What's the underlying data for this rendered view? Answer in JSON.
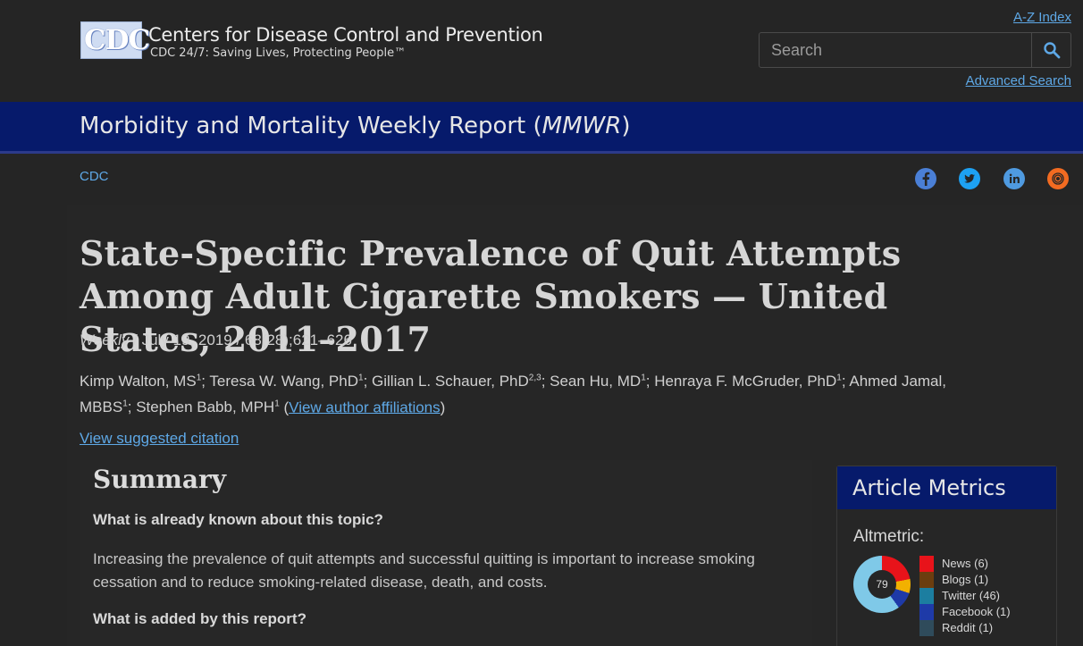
{
  "header": {
    "logo_text": "CDC",
    "org_name": "Centers for Disease Control and Prevention",
    "tagline": "CDC 24/7: Saving Lives, Protecting People™",
    "az_index": "A-Z Index",
    "search_placeholder": "Search",
    "advanced_search": "Advanced Search"
  },
  "banner": {
    "title_prefix": "Morbidity and Mortality Weekly Report (",
    "title_italic": "MMWR",
    "title_suffix": ")"
  },
  "breadcrumb": "CDC",
  "social": [
    "facebook-icon",
    "twitter-icon",
    "linkedin-icon",
    "syndicate-icon"
  ],
  "article": {
    "title": "State-Specific Prevalence of Quit Attempts Among Adult Cigarette Smokers — United States, 2011–2017",
    "pub_weekly": "Weekly",
    "pub_rest": " / July 19, 2019 / 68(28);621–626",
    "authors": [
      {
        "name": "Kimp Walton, MS",
        "sup": "1",
        "sep": "; "
      },
      {
        "name": "Teresa W. Wang, PhD",
        "sup": "1",
        "sep": "; "
      },
      {
        "name": "Gillian L. Schauer, PhD",
        "sup": "2,3",
        "sep": "; "
      },
      {
        "name": "Sean Hu, MD",
        "sup": "1",
        "sep": "; "
      },
      {
        "name": "Henraya F. McGruder, PhD",
        "sup": "1",
        "sep": "; "
      },
      {
        "name": "Ahmed Jamal, MBBS",
        "sup": "1",
        "sep": "; "
      },
      {
        "name": "Stephen Babb, MPH",
        "sup": "1",
        "sep": " "
      }
    ],
    "affiliations_link": "View author affiliations",
    "citation_link": "View suggested citation"
  },
  "summary": {
    "heading": "Summary",
    "q1": "What is already known about this topic?",
    "a1": "Increasing the prevalence of quit attempts and successful quitting is important to increase smoking cessation and to reduce smoking-related disease, death, and costs.",
    "q2": "What is added by this report?"
  },
  "metrics": {
    "title": "Article Metrics",
    "altmetric_label": "Altmetric:",
    "score": "79",
    "items": [
      {
        "label": "News (6)",
        "color": "#e8131a"
      },
      {
        "label": "Blogs (1)",
        "color": "#6b3d0f"
      },
      {
        "label": "Twitter (46)",
        "color": "#1c7ea0"
      },
      {
        "label": "Facebook (1)",
        "color": "#1e3aa8"
      },
      {
        "label": "Reddit (1)",
        "color": "#2f4b5b"
      }
    ]
  },
  "colors": {
    "banner": "#061a6b",
    "link": "#5ea8e6",
    "background": "#252525"
  }
}
